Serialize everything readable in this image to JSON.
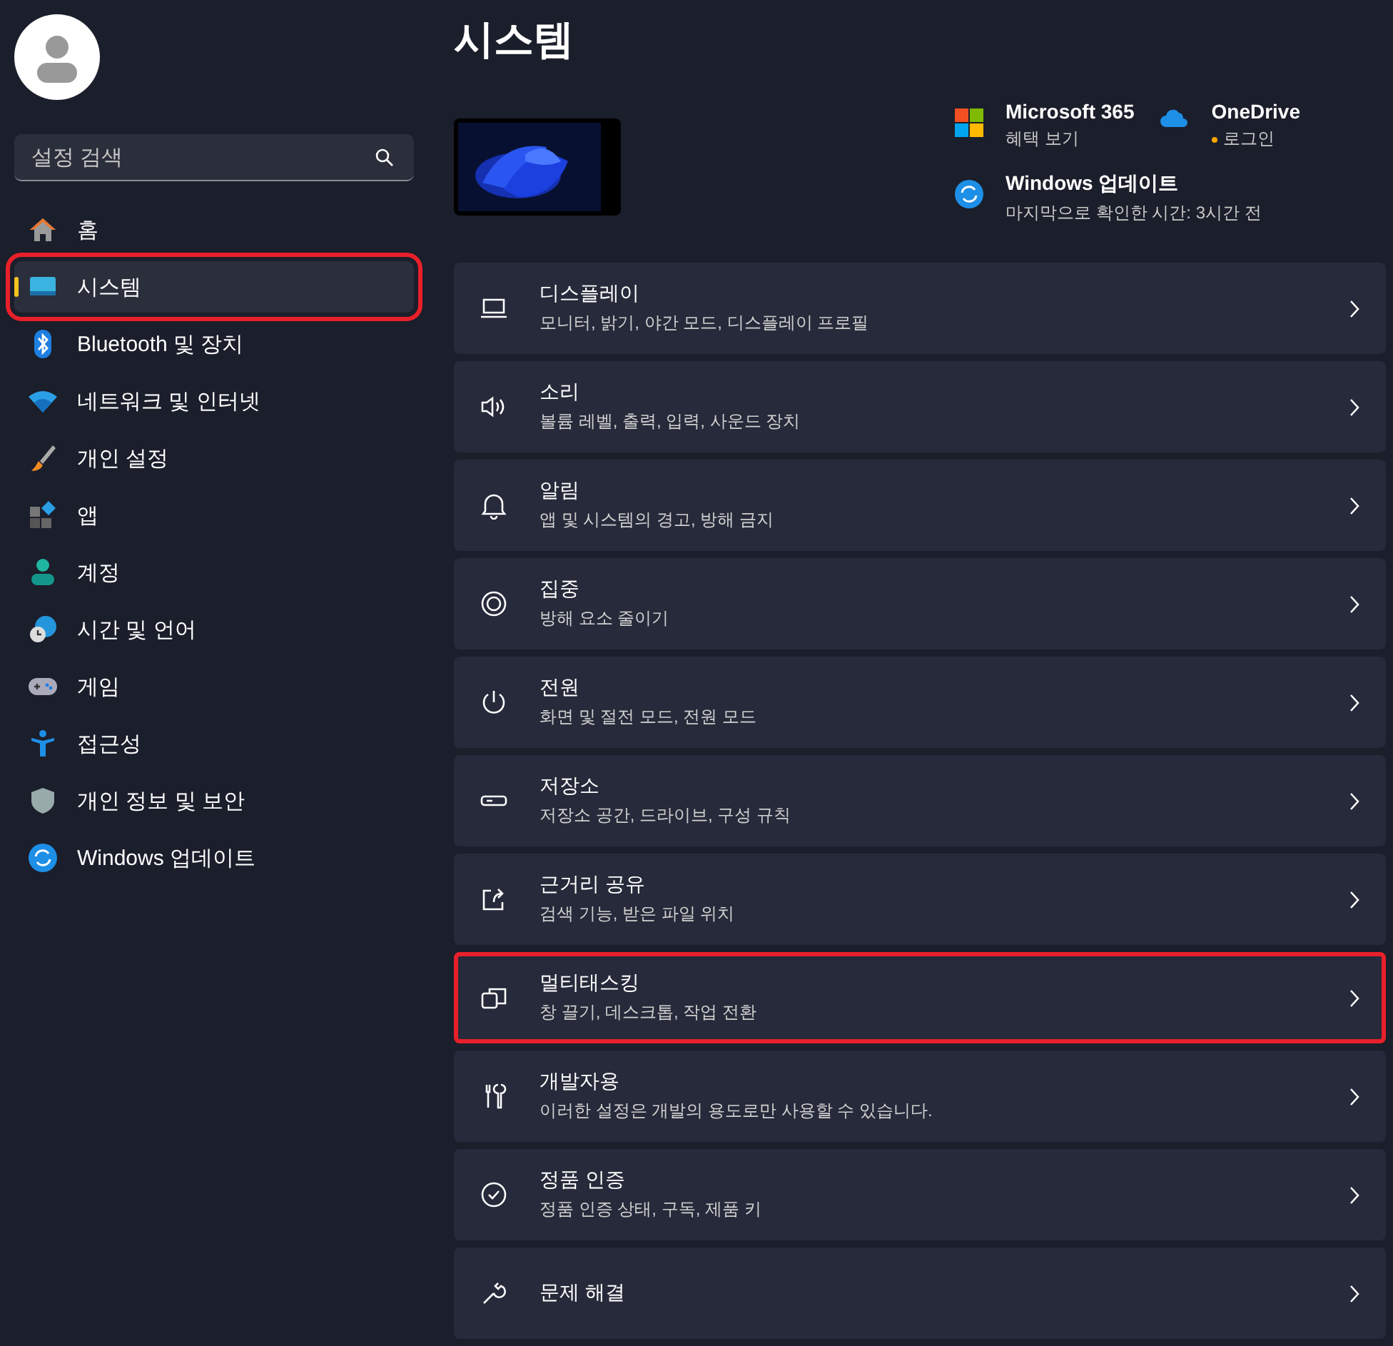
{
  "header": {
    "title": "시스템"
  },
  "sidebar": {
    "search": {
      "placeholder": "설정 검색"
    },
    "items": [
      {
        "label": "홈",
        "selected": false,
        "highlighted": false
      },
      {
        "label": "시스템",
        "selected": true,
        "highlighted": true
      },
      {
        "label": "Bluetooth 및 장치",
        "selected": false,
        "highlighted": false
      },
      {
        "label": "네트워크 및 인터넷",
        "selected": false,
        "highlighted": false
      },
      {
        "label": "개인 설정",
        "selected": false,
        "highlighted": false
      },
      {
        "label": "앱",
        "selected": false,
        "highlighted": false
      },
      {
        "label": "계정",
        "selected": false,
        "highlighted": false
      },
      {
        "label": "시간 및 언어",
        "selected": false,
        "highlighted": false
      },
      {
        "label": "게임",
        "selected": false,
        "highlighted": false
      },
      {
        "label": "접근성",
        "selected": false,
        "highlighted": false
      },
      {
        "label": "개인 정보 및 보안",
        "selected": false,
        "highlighted": false
      },
      {
        "label": "Windows 업데이트",
        "selected": false,
        "highlighted": false
      }
    ]
  },
  "device": {
    "services": [
      {
        "title": "Microsoft 365",
        "subtitle": "혜택 보기"
      },
      {
        "title": "OneDrive",
        "subtitle": "로그인"
      },
      {
        "title": "Windows 업데이트",
        "subtitle": "마지막으로 확인한 시간: 3시간 전"
      }
    ]
  },
  "cards": [
    {
      "title": "디스플레이",
      "subtitle": "모니터, 밝기, 야간 모드, 디스플레이 프로필",
      "highlighted": false
    },
    {
      "title": "소리",
      "subtitle": "볼륨 레벨, 출력, 입력, 사운드 장치",
      "highlighted": false
    },
    {
      "title": "알림",
      "subtitle": "앱 및 시스템의 경고, 방해 금지",
      "highlighted": false
    },
    {
      "title": "집중",
      "subtitle": "방해 요소 줄이기",
      "highlighted": false
    },
    {
      "title": "전원",
      "subtitle": "화면 및 절전 모드, 전원 모드",
      "highlighted": false
    },
    {
      "title": "저장소",
      "subtitle": "저장소 공간, 드라이브, 구성 규칙",
      "highlighted": false
    },
    {
      "title": "근거리 공유",
      "subtitle": "검색 기능, 받은 파일 위치",
      "highlighted": false
    },
    {
      "title": "멀티태스킹",
      "subtitle": "창 끌기, 데스크톱, 작업 전환",
      "highlighted": true
    },
    {
      "title": "개발자용",
      "subtitle": "이러한 설정은 개발의 용도로만 사용할 수 있습니다.",
      "highlighted": false
    },
    {
      "title": "정품 인증",
      "subtitle": "정품 인증 상태, 구독, 제품 키",
      "highlighted": false
    },
    {
      "title": "문제 해결",
      "highlighted": false
    }
  ]
}
